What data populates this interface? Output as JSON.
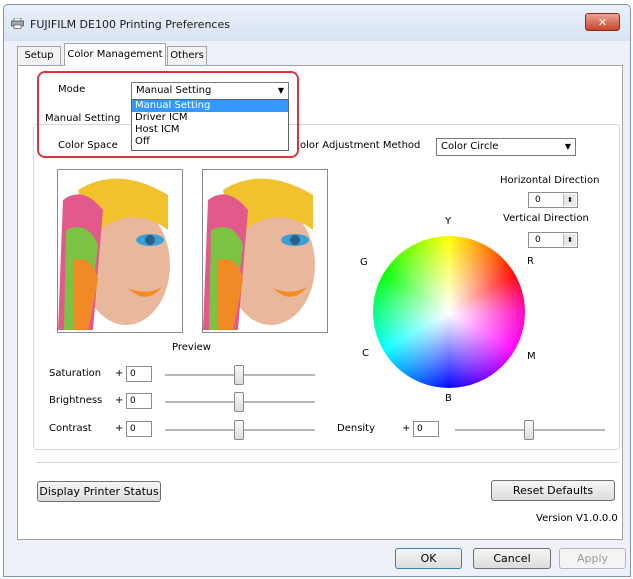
{
  "window": {
    "title": "FUJIFILM DE100 Printing Preferences",
    "close_label": "✕"
  },
  "tabs": [
    {
      "label": "Setup",
      "active": false
    },
    {
      "label": "Color Management",
      "active": true
    },
    {
      "label": "Others",
      "active": false
    }
  ],
  "mode": {
    "label": "Mode",
    "value": "Manual Setting",
    "options": [
      "Manual Setting",
      "Driver ICM",
      "Host ICM",
      "Off"
    ],
    "highlighted_option": "Manual Setting"
  },
  "manual_setting": {
    "label": "Manual Setting"
  },
  "color_space": {
    "label": "Color Space"
  },
  "adjustment_method": {
    "label": "olor Adjustment Method",
    "value": "Color Circle"
  },
  "preview": {
    "label": "Preview"
  },
  "direction": {
    "horizontal_label": "Horizontal Direction",
    "horizontal_value": "0",
    "vertical_label": "Vertical Direction",
    "vertical_value": "0"
  },
  "wheel_labels": {
    "Y": "Y",
    "R": "R",
    "G": "G",
    "C": "C",
    "M": "M",
    "B": "B"
  },
  "sliders": {
    "saturation": {
      "label": "Saturation",
      "sign": "+",
      "value": "0",
      "position": 0.5
    },
    "brightness": {
      "label": "Brightness",
      "sign": "+",
      "value": "0",
      "position": 0.5
    },
    "contrast": {
      "label": "Contrast",
      "sign": "+",
      "value": "0",
      "position": 0.5
    },
    "density": {
      "label": "Density",
      "sign": "+",
      "value": "0",
      "position": 0.5
    }
  },
  "buttons": {
    "display_status": "Display Printer Status",
    "reset_defaults": "Reset Defaults",
    "ok": "OK",
    "cancel": "Cancel",
    "apply": "Apply"
  },
  "version": "Version V1.0.0.0",
  "colors": {
    "highlight_border": "#e0333d",
    "selection": "#3399ff",
    "close_button": "#c9442b"
  }
}
